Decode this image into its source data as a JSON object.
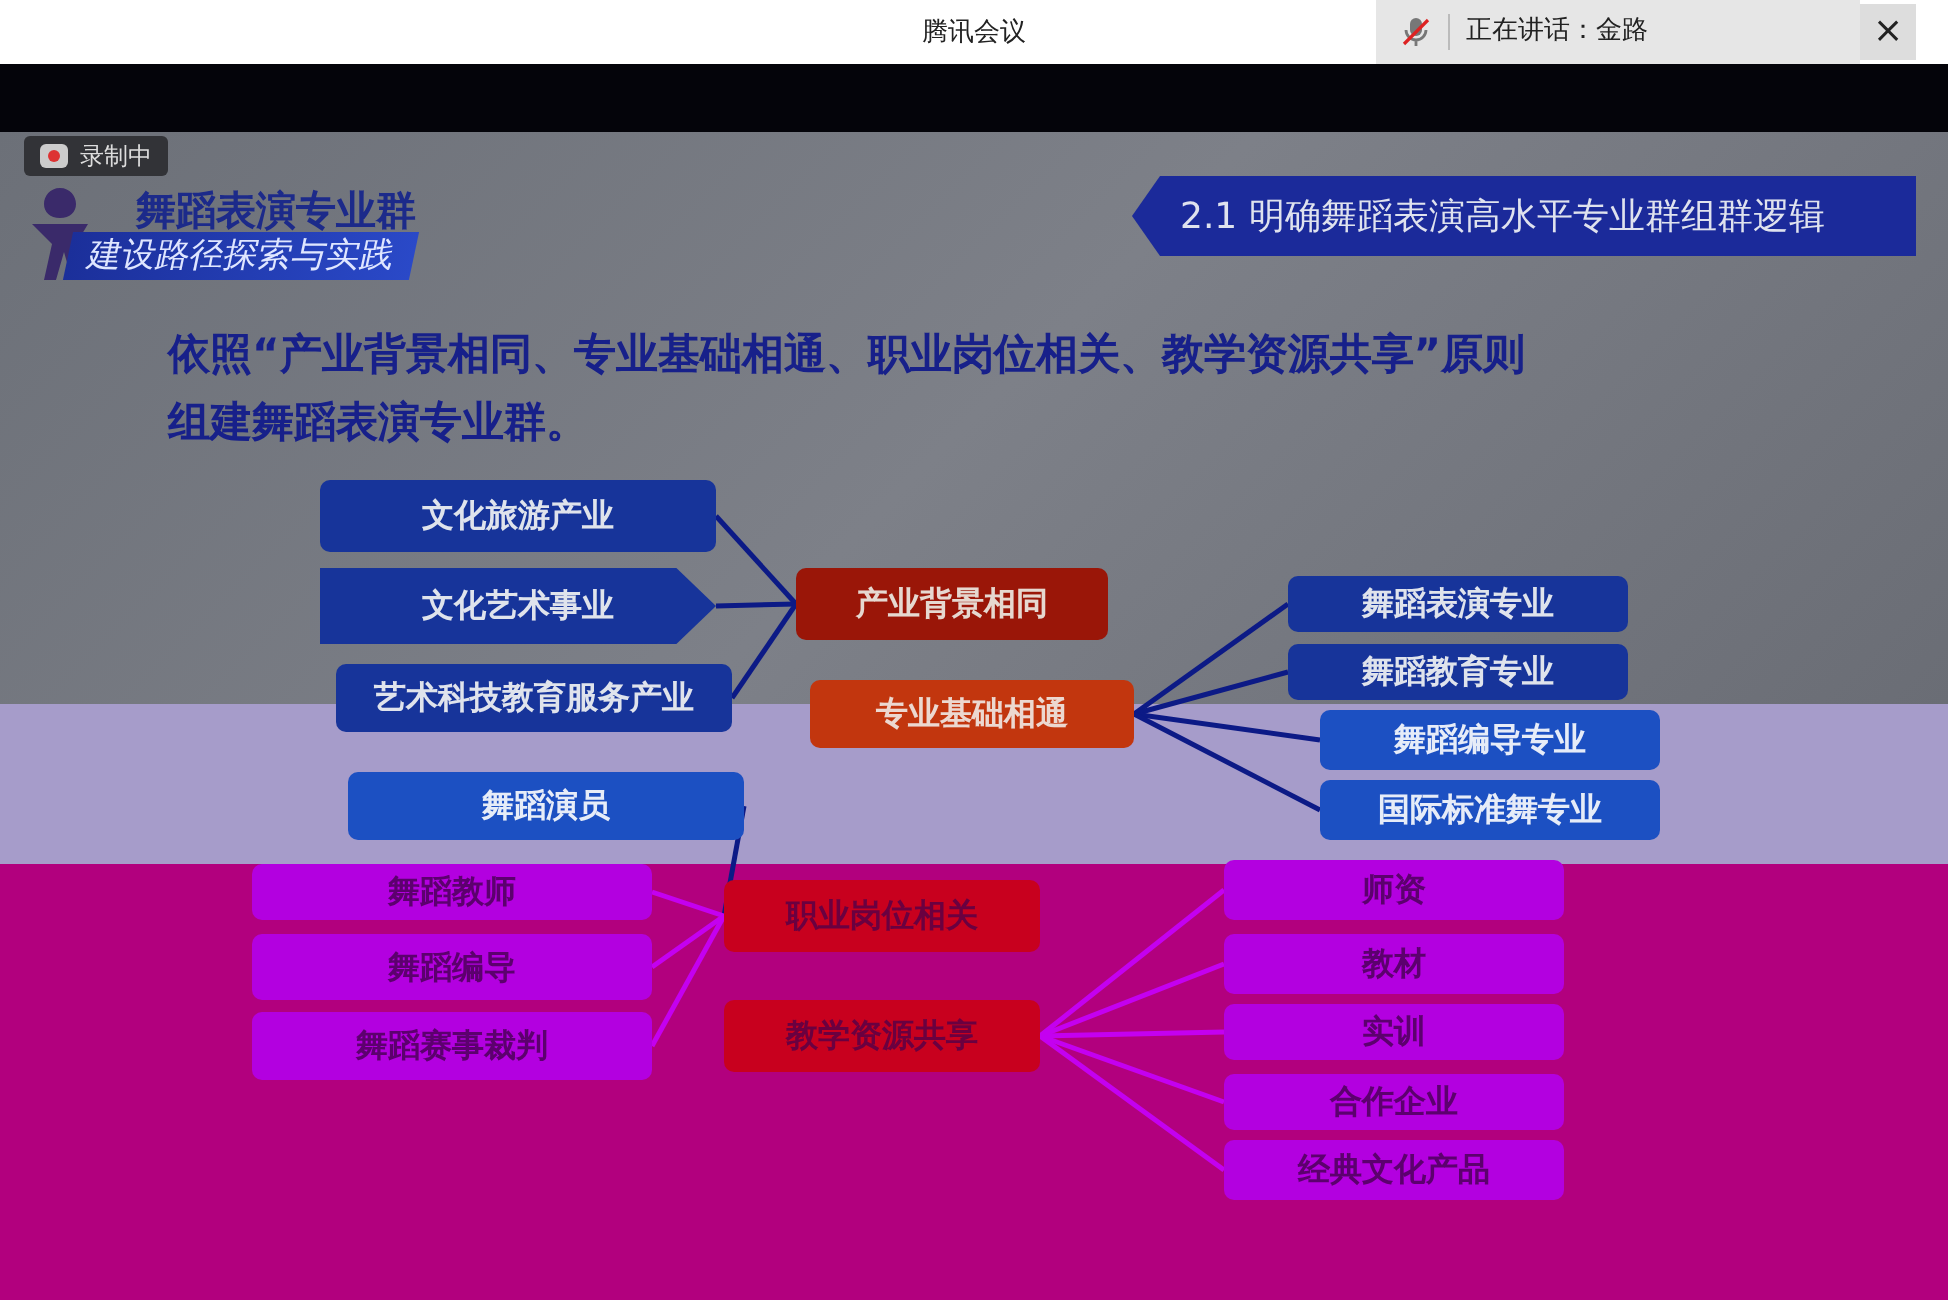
{
  "window": {
    "title": "腾讯会议",
    "close": "×"
  },
  "speaker_panel": {
    "mic_muted": true,
    "speaking": "正在讲话：金路"
  },
  "recording_badge": {
    "label": "录制中"
  },
  "slide": {
    "logo_title": "舞蹈表演专业群",
    "logo_subtitle": "建设路径探索与实践",
    "heading": "2.1 明确舞蹈表演高水平专业群组群逻辑",
    "intro": [
      "依照“产业背景相同、专业基础相通、职业岗位相关、教学资源共享”原则",
      "组建舞蹈表演专业群。"
    ],
    "groups": [
      {
        "label": "产业背景相同",
        "kind": "sources",
        "items": [
          "文化旅游产业",
          "文化艺术事业",
          "艺术科技教育服务产业"
        ]
      },
      {
        "label": "专业基础相通",
        "kind": "targets",
        "items": [
          "舞蹈表演专业",
          "舞蹈教育专业",
          "舞蹈编导专业",
          "国际标准舞专业"
        ]
      },
      {
        "label": "职业岗位相关",
        "kind": "sources",
        "items": [
          "舞蹈演员",
          "舞蹈教师",
          "舞蹈编导",
          "舞蹈赛事裁判"
        ]
      },
      {
        "label": "教学资源共享",
        "kind": "targets",
        "items": [
          "师资",
          "教材",
          "实训",
          "合作企业",
          "经典文化产品"
        ]
      }
    ]
  }
}
